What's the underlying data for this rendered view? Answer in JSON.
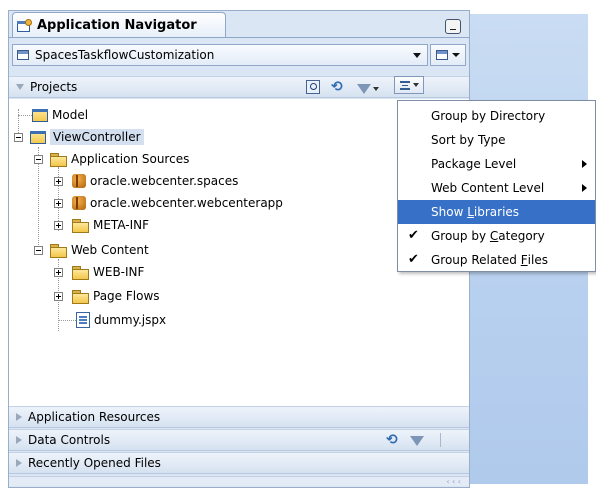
{
  "window": {
    "tab_title": "Application Navigator",
    "application_selector": "SpacesTaskflowCustomization"
  },
  "projects_panel": {
    "header": "Projects",
    "tree": [
      {
        "label": "Model",
        "icon": "project-icon"
      },
      {
        "label": "ViewController",
        "icon": "project-icon",
        "selected": true
      },
      {
        "label": "Application Sources",
        "icon": "folder-icon"
      },
      {
        "label": "oracle.webcenter.spaces",
        "icon": "package-icon"
      },
      {
        "label": "oracle.webcenter.webcenterapp",
        "icon": "package-icon"
      },
      {
        "label": "META-INF",
        "icon": "folder-icon"
      },
      {
        "label": "Web Content",
        "icon": "folder-icon"
      },
      {
        "label": "WEB-INF",
        "icon": "folder-icon"
      },
      {
        "label": "Page Flows",
        "icon": "folder-icon"
      },
      {
        "label": "dummy.jspx",
        "icon": "page-icon"
      }
    ]
  },
  "context_menu": {
    "items": [
      {
        "label": "Group by Directory",
        "checked": false,
        "submenu": false
      },
      {
        "label": "Sort by Type",
        "checked": false,
        "submenu": false
      },
      {
        "label": "Package Level",
        "checked": false,
        "submenu": true
      },
      {
        "label": "Web Content Level",
        "checked": false,
        "submenu": true
      },
      {
        "label_pre": "Show ",
        "label_mn": "L",
        "label_post": "ibraries",
        "checked": false,
        "submenu": false,
        "highlighted": true
      },
      {
        "label_pre": "Group by ",
        "label_mn": "C",
        "label_post": "ategory",
        "checked": true,
        "submenu": false
      },
      {
        "label_pre": "Group Related ",
        "label_mn": "F",
        "label_post": "iles",
        "checked": true,
        "submenu": false
      }
    ]
  },
  "sections": {
    "application_resources": "Application Resources",
    "data_controls": "Data Controls",
    "recently_opened": "Recently Opened Files"
  },
  "colors": {
    "highlight": "#3670c7",
    "panel_bg": "#dbe6f4",
    "right_bg": "#b8d0ef"
  }
}
